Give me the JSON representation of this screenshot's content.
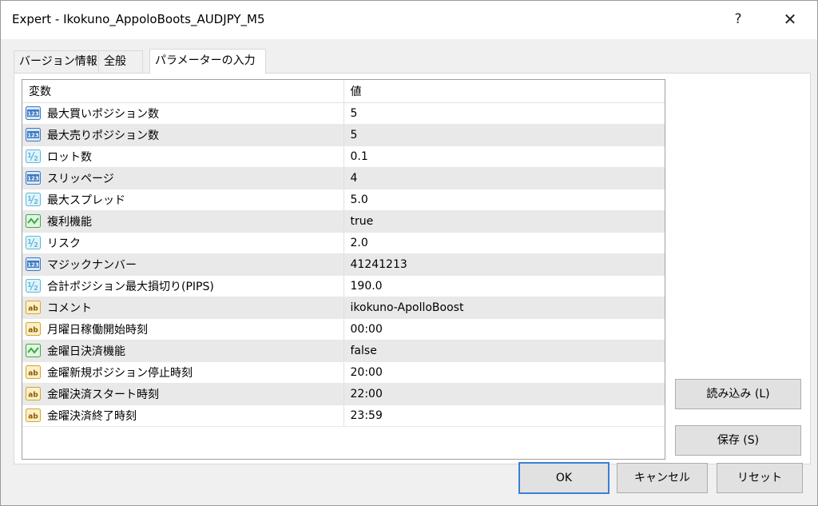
{
  "window": {
    "title": "Expert - Ikokuno_AppoloBoots_AUDJPY_M5",
    "help_label": "?",
    "close_label": "✕"
  },
  "tabs": [
    {
      "label": "バージョン情報"
    },
    {
      "label": "全般"
    },
    {
      "label": "パラメーターの入力"
    }
  ],
  "grid": {
    "headers": {
      "name": "変数",
      "value": "値"
    },
    "rows": [
      {
        "icon": "integer-icon",
        "name": "最大買いポジション数",
        "value": "5"
      },
      {
        "icon": "integer-icon",
        "name": "最大売りポジション数",
        "value": "5"
      },
      {
        "icon": "double-icon",
        "name": "ロット数",
        "value": "0.1"
      },
      {
        "icon": "integer-icon",
        "name": "スリッページ",
        "value": "4"
      },
      {
        "icon": "double-icon",
        "name": "最大スプレッド",
        "value": "5.0"
      },
      {
        "icon": "bool-icon",
        "name": "複利機能",
        "value": "true"
      },
      {
        "icon": "double-icon",
        "name": "リスク",
        "value": "2.0"
      },
      {
        "icon": "integer-icon",
        "name": "マジックナンバー",
        "value": "41241213"
      },
      {
        "icon": "double-icon",
        "name": "合計ポジション最大損切り(PIPS)",
        "value": "190.0"
      },
      {
        "icon": "string-icon",
        "name": "コメント",
        "value": "ikokuno-ApolloBoost"
      },
      {
        "icon": "string-icon",
        "name": "月曜日稼働開始時刻",
        "value": "00:00"
      },
      {
        "icon": "bool-icon",
        "name": "金曜日決済機能",
        "value": "false"
      },
      {
        "icon": "string-icon",
        "name": "金曜新規ポジション停止時刻",
        "value": "20:00"
      },
      {
        "icon": "string-icon",
        "name": "金曜決済スタート時刻",
        "value": "22:00"
      },
      {
        "icon": "string-icon",
        "name": "金曜決済終了時刻",
        "value": "23:59"
      }
    ]
  },
  "buttons": {
    "load": "読み込み (L)",
    "save": "保存 (S)",
    "ok": "OK",
    "cancel": "キャンセル",
    "reset": "リセット"
  },
  "colors": {
    "integer_icon": "#3b78c4",
    "double_icon": "#5fb7d9",
    "bool_icon": "#3ea845",
    "string_icon": "#d9a52a",
    "default_button_border": "#3c7fd6"
  }
}
